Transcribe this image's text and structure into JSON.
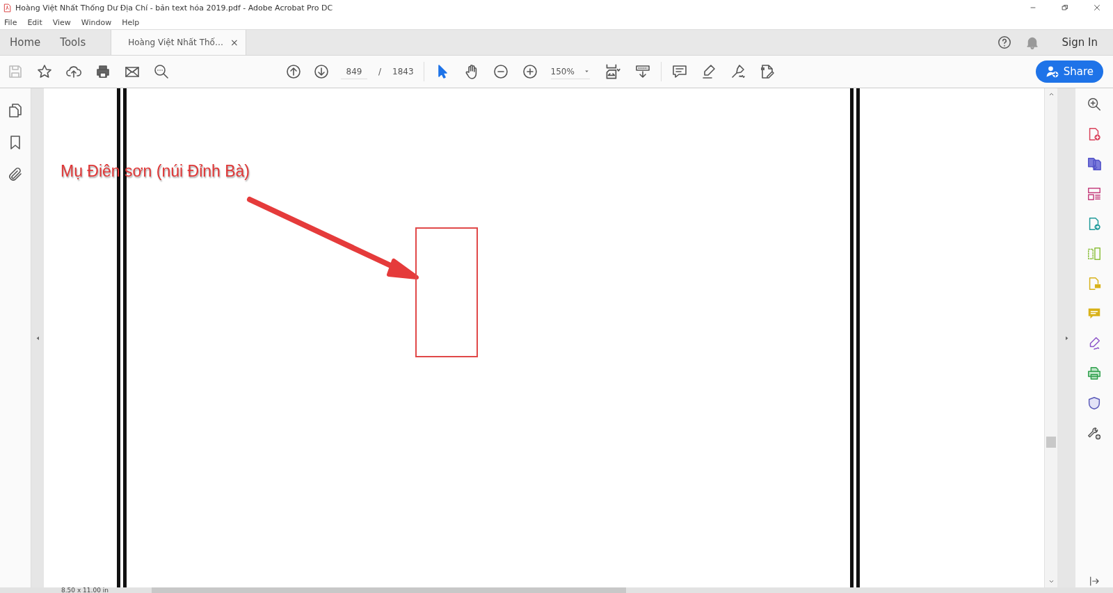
{
  "window": {
    "title": "Hoàng Việt Nhất Thống Dư Địa Chí - bản text hóa 2019.pdf - Adobe Acrobat Pro DC"
  },
  "menu": [
    "File",
    "Edit",
    "View",
    "Window",
    "Help"
  ],
  "tabs": [
    {
      "label": "Home",
      "selected": false
    },
    {
      "label": "Tools",
      "selected": false
    },
    {
      "label": "Hoàng Việt Nhất Thố…",
      "selected": true,
      "close": "×"
    }
  ],
  "sign_in": "Sign In",
  "toolbar": {
    "page_current": "849",
    "page_separator": "/",
    "page_total": "1843",
    "zoom": "150%",
    "share": "Share"
  },
  "annotation": {
    "text": "Mụ Điên sơn (núi Đỉnh Bà)"
  },
  "status": {
    "page_size": "8.50 x 11.00 in"
  }
}
